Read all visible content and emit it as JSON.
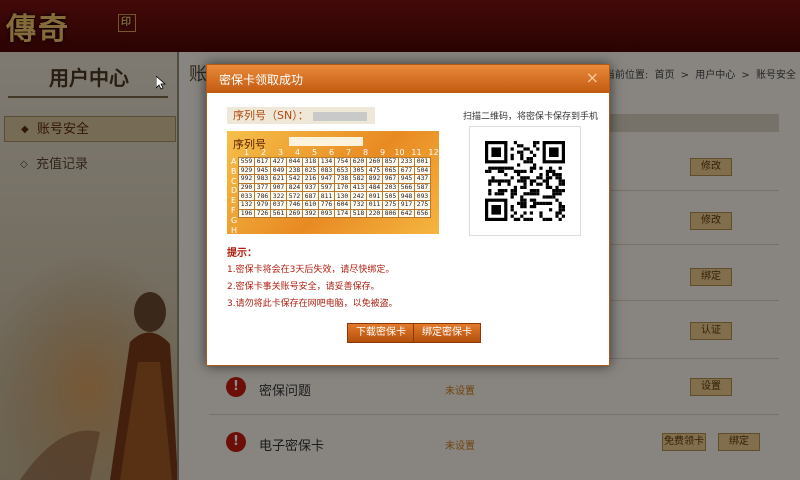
{
  "logo": {
    "text": "傳奇",
    "seal": "印"
  },
  "sidebar": {
    "title": "用户中心",
    "items": [
      {
        "label": "账号安全",
        "active": true
      },
      {
        "label": "充值记录",
        "active": false
      }
    ]
  },
  "main": {
    "heading": "账号安全",
    "breadcrumb": {
      "prefix": "当前位置:",
      "path": [
        "首页",
        ">",
        "用户中心",
        ">",
        "账号安全"
      ]
    },
    "rows": [
      {
        "label": "",
        "status": "",
        "buttons": [
          "修改"
        ]
      },
      {
        "label": "",
        "status": "",
        "buttons": [
          "修改"
        ]
      },
      {
        "label": "",
        "status": "",
        "buttons": [
          "绑定"
        ]
      },
      {
        "label": "",
        "status": "",
        "buttons": [
          "认证"
        ]
      },
      {
        "label": "密保问题",
        "status": "未设置",
        "buttons": [
          "设置"
        ]
      },
      {
        "label": "电子密保卡",
        "status": "未设置",
        "buttons": [
          "免费领卡",
          "绑定"
        ]
      }
    ]
  },
  "modal": {
    "title": "密保卡领取成功",
    "close_icon": "×",
    "sn_label": "序列号（SN）：",
    "card_label": "序列号",
    "columns": [
      "1",
      "2",
      "3",
      "4",
      "5",
      "6",
      "7",
      "8",
      "9",
      "10",
      "11",
      "12"
    ],
    "rows_labels": [
      "A",
      "B",
      "C",
      "D",
      "E",
      "F",
      "G",
      "H"
    ],
    "grid": [
      [
        "559",
        "617",
        "427",
        "044",
        "318",
        "134",
        "754",
        "620",
        "260",
        "857",
        "233",
        "001"
      ],
      [
        "929",
        "945",
        "049",
        "238",
        "025",
        "083",
        "653",
        "305",
        "475",
        "065",
        "677",
        "504"
      ],
      [
        "992",
        "983",
        "621",
        "542",
        "216",
        "947",
        "738",
        "582",
        "892",
        "967",
        "945",
        "437"
      ],
      [
        "290",
        "377",
        "907",
        "824",
        "937",
        "597",
        "170",
        "413",
        "484",
        "203",
        "566",
        "587"
      ],
      [
        "033",
        "786",
        "322",
        "572",
        "687",
        "811",
        "130",
        "242",
        "091",
        "505",
        "948",
        "093"
      ],
      [
        "132",
        "979",
        "037",
        "746",
        "610",
        "776",
        "604",
        "732",
        "011",
        "275",
        "917",
        "275"
      ],
      [
        "196",
        "726",
        "561",
        "269",
        "392",
        "093",
        "174",
        "518",
        "220",
        "806",
        "642",
        "656"
      ]
    ],
    "qr_caption": "扫描二维码，将密保卡保存到手机",
    "tips_title": "提示：",
    "tips": [
      "1.密保卡将会在3天后失效，请尽快绑定。",
      "2.密保卡事关账号安全，请妥善保存。",
      "3.请勿将此卡保存在网吧电脑，以免被盗。"
    ],
    "buttons": {
      "download": "下载密保卡",
      "bind": "绑定密保卡"
    }
  },
  "colors": {
    "accent": "#c25a12",
    "tip_text": "#b02010",
    "header_bg": "#6a0e0b"
  }
}
